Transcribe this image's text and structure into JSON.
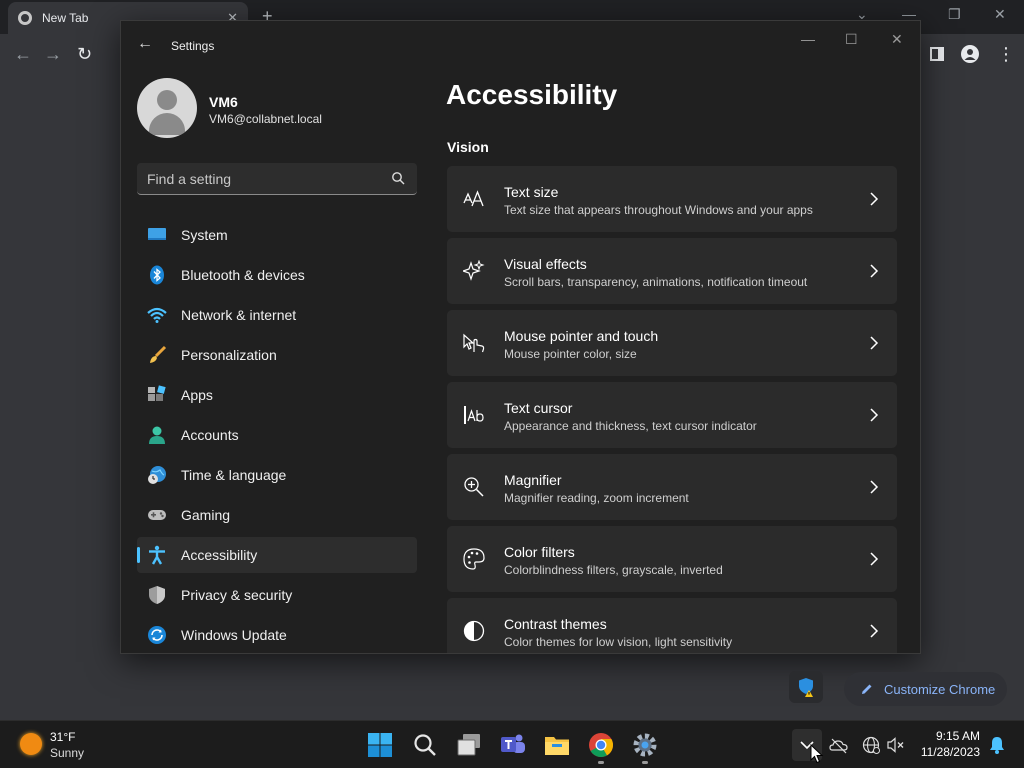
{
  "browser": {
    "tab_title": "New Tab",
    "tab_close": "✕",
    "new_tab": "+",
    "customize_label": "Customize Chrome"
  },
  "settings_window": {
    "title": "Settings",
    "user": {
      "name": "VM6",
      "email": "VM6@collabnet.local"
    },
    "search_placeholder": "Find a setting",
    "nav_items": [
      {
        "label": "System",
        "icon": "system-icon"
      },
      {
        "label": "Bluetooth & devices",
        "icon": "bluetooth-icon"
      },
      {
        "label": "Network & internet",
        "icon": "wifi-icon"
      },
      {
        "label": "Personalization",
        "icon": "brush-icon"
      },
      {
        "label": "Apps",
        "icon": "apps-icon"
      },
      {
        "label": "Accounts",
        "icon": "accounts-icon"
      },
      {
        "label": "Time & language",
        "icon": "globe-clock-icon"
      },
      {
        "label": "Gaming",
        "icon": "gamepad-icon"
      },
      {
        "label": "Accessibility",
        "icon": "accessibility-icon",
        "active": true
      },
      {
        "label": "Privacy & security",
        "icon": "shield-icon"
      },
      {
        "label": "Windows Update",
        "icon": "update-icon"
      }
    ],
    "page_title": "Accessibility",
    "section": "Vision",
    "cards": [
      {
        "title": "Text size",
        "desc": "Text size that appears throughout Windows and your apps",
        "icon": "text-size-icon"
      },
      {
        "title": "Visual effects",
        "desc": "Scroll bars, transparency, animations, notification timeout",
        "icon": "sparkle-icon"
      },
      {
        "title": "Mouse pointer and touch",
        "desc": "Mouse pointer color, size",
        "icon": "pointer-touch-icon"
      },
      {
        "title": "Text cursor",
        "desc": "Appearance and thickness, text cursor indicator",
        "icon": "text-cursor-icon"
      },
      {
        "title": "Magnifier",
        "desc": "Magnifier reading, zoom increment",
        "icon": "magnifier-icon"
      },
      {
        "title": "Color filters",
        "desc": "Colorblindness filters, grayscale, inverted",
        "icon": "palette-icon"
      },
      {
        "title": "Contrast themes",
        "desc": "Color themes for low vision, light sensitivity",
        "icon": "contrast-icon"
      }
    ]
  },
  "taskbar": {
    "weather_temp": "31°F",
    "weather_cond": "Sunny",
    "time": "9:15 AM",
    "date": "11/28/2023"
  },
  "colors": {
    "accent": "#4cc2ff",
    "window_bg": "#202020",
    "card_bg": "#2b2b2b",
    "link_blue": "#8ab4f8"
  }
}
